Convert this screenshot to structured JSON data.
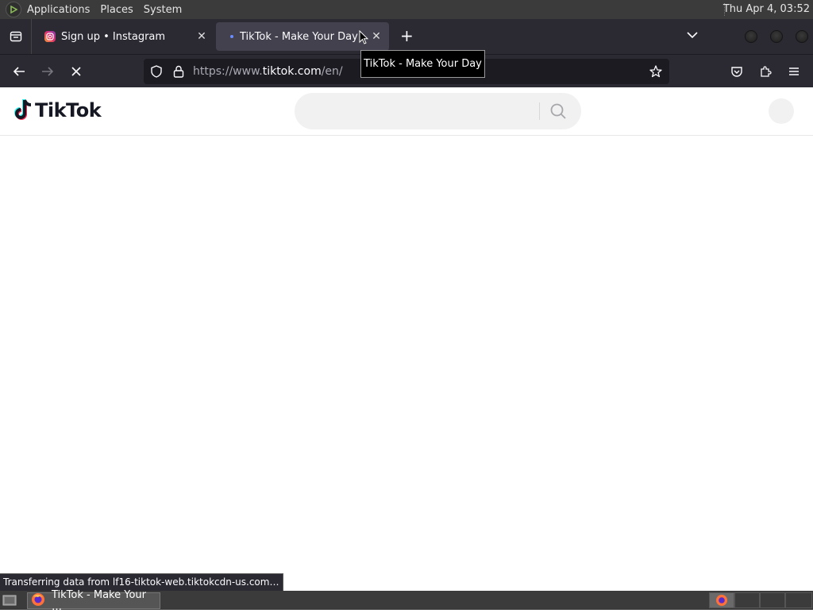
{
  "top_panel": {
    "menus": [
      "Applications",
      "Places",
      "System"
    ],
    "clock": "Thu Apr  4, 03:52"
  },
  "tabs": [
    {
      "title": "Sign up • Instagram",
      "active": false
    },
    {
      "title": "TikTok - Make Your Day",
      "active": true
    }
  ],
  "tooltip": "TikTok - Make Your Day",
  "urlbar": {
    "prefix": "https://www.",
    "host": "tiktok.com",
    "path": "/en/"
  },
  "page": {
    "logo_text": "TikTok",
    "search_placeholder": ""
  },
  "status_text": "Transferring data from lf16-tiktok-web.tiktokcdn-us.com…",
  "taskbar": {
    "window_label": "TikTok - Make Your …"
  },
  "colors": {
    "panel": "#3b3b3b",
    "toolbar": "#2b2a33",
    "tiktok_red": "#fe2c55",
    "tiktok_cyan": "#25f4ee"
  }
}
